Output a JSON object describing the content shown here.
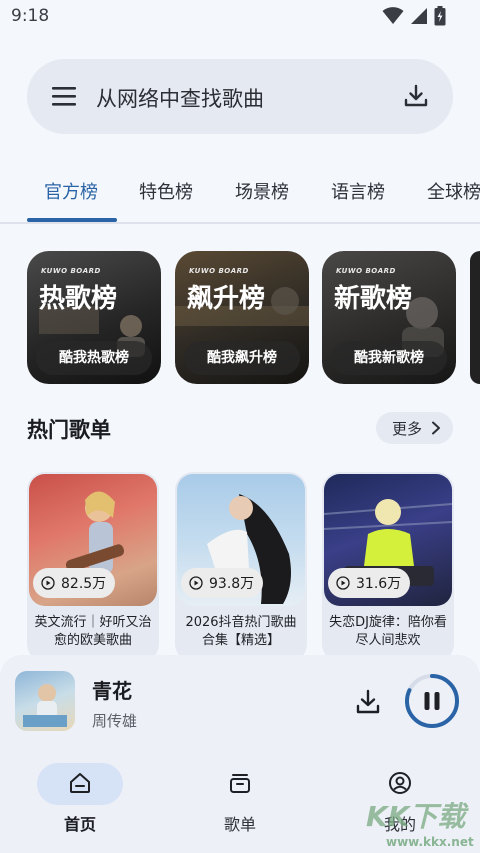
{
  "status_bar": {
    "time": "9:18",
    "icons": [
      "wifi-icon",
      "signal-icon",
      "battery-icon"
    ]
  },
  "search": {
    "menu_icon": "menu-icon",
    "placeholder": "从网络中查找歌曲",
    "download_icon": "download-icon"
  },
  "tabs": [
    {
      "label": "官方榜",
      "active": true
    },
    {
      "label": "特色榜",
      "active": false
    },
    {
      "label": "场景榜",
      "active": false
    },
    {
      "label": "语言榜",
      "active": false
    },
    {
      "label": "全球榜",
      "active": false
    }
  ],
  "boards": [
    {
      "brand": "KUWO BOARD",
      "title": "热歌榜",
      "button": "酷我热歌榜"
    },
    {
      "brand": "KUWO BOARD",
      "title": "飙升榜",
      "button": "酷我飙升榜"
    },
    {
      "brand": "KUWO BOARD",
      "title": "新歌榜",
      "button": "酷我新歌榜"
    }
  ],
  "hot_playlists": {
    "title": "热门歌单",
    "more_label": "更多",
    "items": [
      {
        "play_count": "82.5万",
        "name": "英文流行｜好听又治愈的欧美歌曲"
      },
      {
        "play_count": "93.8万",
        "name": "2026抖音热门歌曲合集【精选】"
      },
      {
        "play_count": "31.6万",
        "name": "失恋DJ旋律：陪你看尽人间悲欢"
      }
    ]
  },
  "player": {
    "song_title": "青花",
    "artist": "周传雄",
    "progress": 0.82,
    "accent": "#2a64a6"
  },
  "bottom_nav": [
    {
      "label": "首页",
      "icon": "home-icon",
      "active": true
    },
    {
      "label": "歌单",
      "icon": "playlist-icon",
      "active": false
    },
    {
      "label": "我的",
      "icon": "profile-icon",
      "active": false
    }
  ],
  "watermark": {
    "logo": "KK下载",
    "url": "www.kkx.net"
  }
}
